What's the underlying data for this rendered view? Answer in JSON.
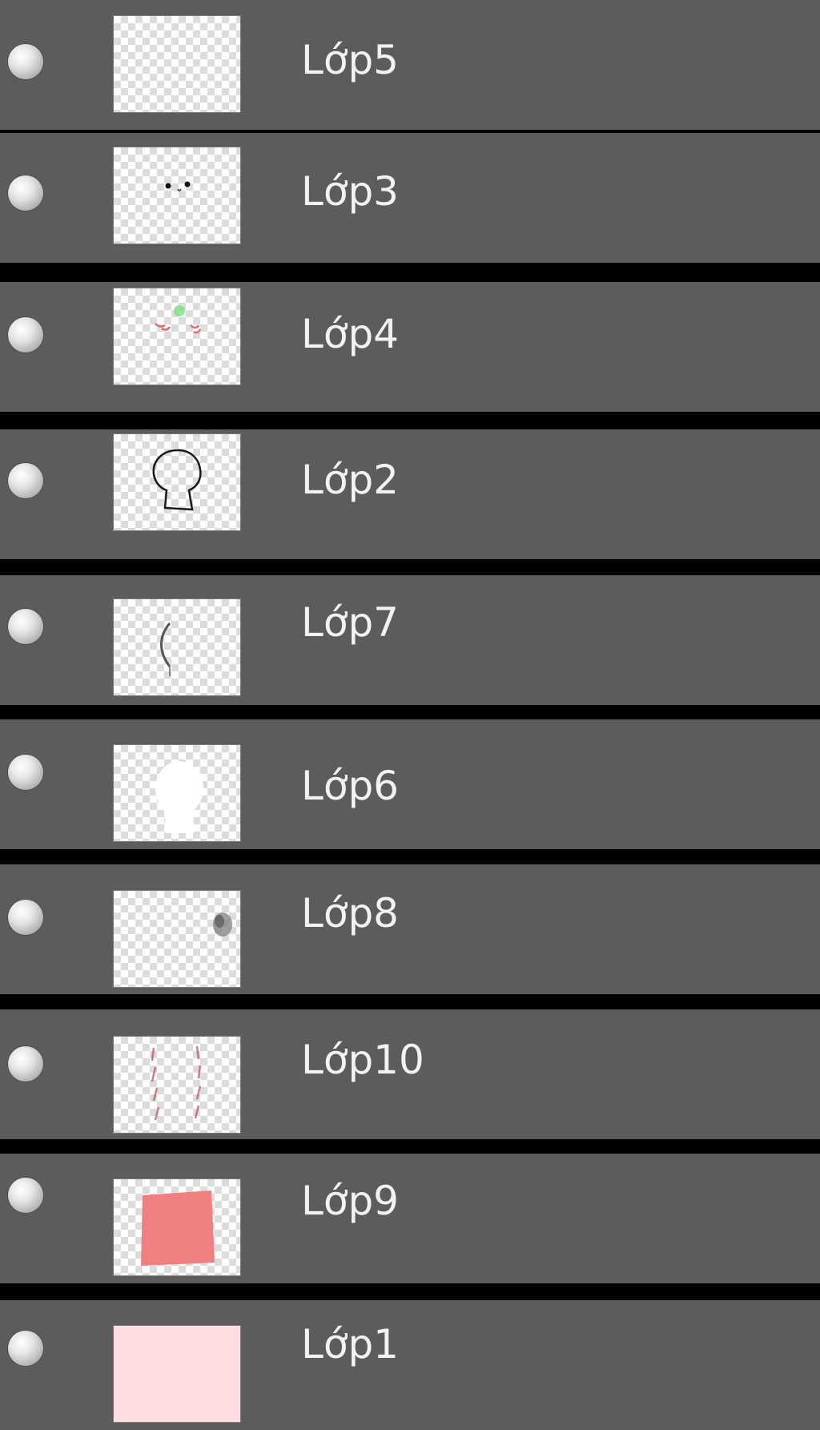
{
  "panel": {
    "row_color": "#5c5c5c",
    "separator_color": "#000000",
    "text_color": "#f2f2f2",
    "layers": [
      {
        "name": "Lớp5",
        "visibility_icon": "visibility-dot-icon",
        "thumbnail": "empty-transparent"
      },
      {
        "name": "Lớp3",
        "visibility_icon": "visibility-dot-icon",
        "thumbnail": "eyes"
      },
      {
        "name": "Lớp4",
        "visibility_icon": "visibility-dot-icon",
        "thumbnail": "pink-green-marks"
      },
      {
        "name": "Lớp2",
        "visibility_icon": "visibility-dot-icon",
        "thumbnail": "head-outline"
      },
      {
        "name": "Lớp7",
        "visibility_icon": "visibility-dot-icon",
        "thumbnail": "curved-stroke"
      },
      {
        "name": "Lớp6",
        "visibility_icon": "visibility-dot-icon",
        "thumbnail": "white-shape"
      },
      {
        "name": "Lớp8",
        "visibility_icon": "visibility-dot-icon",
        "thumbnail": "gray-smudge"
      },
      {
        "name": "Lớp10",
        "visibility_icon": "visibility-dot-icon",
        "thumbnail": "red-dashed-strokes"
      },
      {
        "name": "Lớp9",
        "visibility_icon": "visibility-dot-icon",
        "thumbnail": "salmon-block",
        "fill_color": "#f08080"
      },
      {
        "name": "Lớp1",
        "visibility_icon": "visibility-dot-icon",
        "thumbnail": "solid-pink",
        "fill_color": "#ffdcdf"
      }
    ]
  }
}
